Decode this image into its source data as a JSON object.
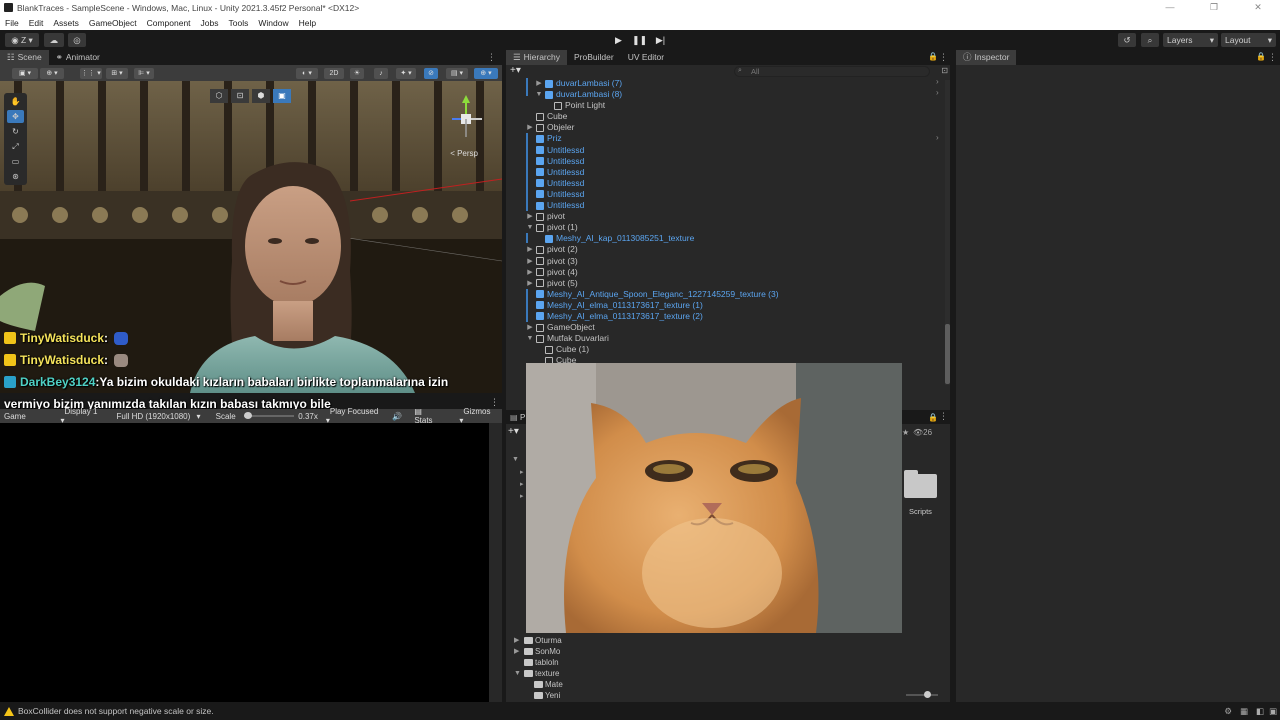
{
  "window": {
    "title": "BlankTraces - SampleScene - Windows, Mac, Linux - Unity 2021.3.45f2 Personal* <DX12>"
  },
  "menu": [
    "File",
    "Edit",
    "Assets",
    "GameObject",
    "Component",
    "Jobs",
    "Tools",
    "Window",
    "Help"
  ],
  "toolbar": {
    "account_label": "Z",
    "layers_label": "Layers",
    "layout_label": "Layout"
  },
  "scene_panel": {
    "tabs": [
      "Scene",
      "Animator"
    ],
    "toggle_2d": "2D",
    "persp_label": "< Persp"
  },
  "chat": [
    {
      "user": "TinyWatisduck",
      "sep": " :",
      "text": "",
      "color": "#f5e35b"
    },
    {
      "user": "TinyWatisduck",
      "sep": " :",
      "text": "",
      "color": "#f5e35b"
    },
    {
      "user": "DarkBey3124",
      "sep": " :",
      "text": " Ya bizim okuldaki kızların babaları birlikte toplanmalarına izin",
      "color": "#4fd1c5"
    }
  ],
  "chat_continuation": "vermiyo bizim yanımızda takılan kızın babası takmıyo bile",
  "game_panel": {
    "tab": "Game",
    "display": "Display 1",
    "resolution": "Full HD (1920x1080)",
    "scale_label": "Scale",
    "scale_value": "0.37x",
    "play_mode": "Play Focused",
    "stats": "Stats",
    "gizmos": "Gizmos"
  },
  "hierarchy": {
    "tabs": [
      "Hierarchy",
      "ProBuilder",
      "UV Editor"
    ],
    "search_placeholder": "All",
    "rows": [
      {
        "label": "duvarLambasi (7)",
        "blue": true,
        "prefab": true,
        "arrow": "▶",
        "indent": 3
      },
      {
        "label": "duvarLambasi (8)",
        "blue": true,
        "prefab": true,
        "arrow": "▼",
        "indent": 3
      },
      {
        "label": "Point Light",
        "blue": false,
        "prefab": false,
        "arrow": "",
        "indent": 4
      },
      {
        "label": "Cube",
        "blue": false,
        "prefab": false,
        "arrow": "",
        "indent": 2
      },
      {
        "label": "Objeler",
        "blue": false,
        "prefab": false,
        "arrow": "▶",
        "indent": 2
      },
      {
        "label": "Priz",
        "blue": true,
        "prefab": true,
        "arrow": "",
        "indent": 2
      },
      {
        "label": "Untitlessd",
        "blue": true,
        "prefab": true,
        "arrow": "",
        "indent": 2
      },
      {
        "label": "Untitlessd",
        "blue": true,
        "prefab": true,
        "arrow": "",
        "indent": 2
      },
      {
        "label": "Untitlessd",
        "blue": true,
        "prefab": true,
        "arrow": "",
        "indent": 2
      },
      {
        "label": "Untitlessd",
        "blue": true,
        "prefab": true,
        "arrow": "",
        "indent": 2
      },
      {
        "label": "Untitlessd",
        "blue": true,
        "prefab": true,
        "arrow": "",
        "indent": 2
      },
      {
        "label": "Untitlessd",
        "blue": true,
        "prefab": true,
        "arrow": "",
        "indent": 2
      },
      {
        "label": "pivot",
        "blue": false,
        "prefab": false,
        "arrow": "▶",
        "indent": 2
      },
      {
        "label": "pivot (1)",
        "blue": false,
        "prefab": false,
        "arrow": "▼",
        "indent": 2
      },
      {
        "label": "Meshy_AI_kap_0113085251_texture",
        "blue": true,
        "prefab": true,
        "arrow": "",
        "indent": 3
      },
      {
        "label": "pivot (2)",
        "blue": false,
        "prefab": false,
        "arrow": "▶",
        "indent": 2
      },
      {
        "label": "pivot (3)",
        "blue": false,
        "prefab": false,
        "arrow": "▶",
        "indent": 2
      },
      {
        "label": "pivot (4)",
        "blue": false,
        "prefab": false,
        "arrow": "▶",
        "indent": 2
      },
      {
        "label": "pivot (5)",
        "blue": false,
        "prefab": false,
        "arrow": "▶",
        "indent": 2
      },
      {
        "label": "Meshy_AI_Antique_Spoon_Eleganc_1227145259_texture (3)",
        "blue": true,
        "prefab": true,
        "arrow": "",
        "indent": 2
      },
      {
        "label": "Meshy_AI_elma_0113173617_texture (1)",
        "blue": true,
        "prefab": true,
        "arrow": "",
        "indent": 2
      },
      {
        "label": "Meshy_AI_elma_0113173617_texture (2)",
        "blue": true,
        "prefab": true,
        "arrow": "",
        "indent": 2
      },
      {
        "label": "GameObject",
        "blue": false,
        "prefab": false,
        "arrow": "▶",
        "indent": 2
      },
      {
        "label": "Mutfak Duvarlari",
        "blue": false,
        "prefab": false,
        "arrow": "▼",
        "indent": 2
      },
      {
        "label": "Cube (1)",
        "blue": false,
        "prefab": false,
        "arrow": "",
        "indent": 3
      },
      {
        "label": "Cube",
        "blue": false,
        "prefab": false,
        "arrow": "",
        "indent": 3
      }
    ]
  },
  "project": {
    "tab_letter": "P",
    "item_count": "26",
    "folders_left": [
      {
        "label": "Oturma",
        "arrow": "▶",
        "indent": 1
      },
      {
        "label": "SonMo",
        "arrow": "▶",
        "indent": 1
      },
      {
        "label": "tabloln",
        "arrow": "",
        "indent": 1
      },
      {
        "label": "texture",
        "arrow": "▼",
        "indent": 1
      },
      {
        "label": "Mate",
        "arrow": "",
        "indent": 2
      },
      {
        "label": "Yeni",
        "arrow": "",
        "indent": 2
      }
    ],
    "grid_folder": "Scripts"
  },
  "inspector": {
    "tab": "Inspector"
  },
  "status": {
    "message": "BoxCollider does not support negative scale or size."
  }
}
